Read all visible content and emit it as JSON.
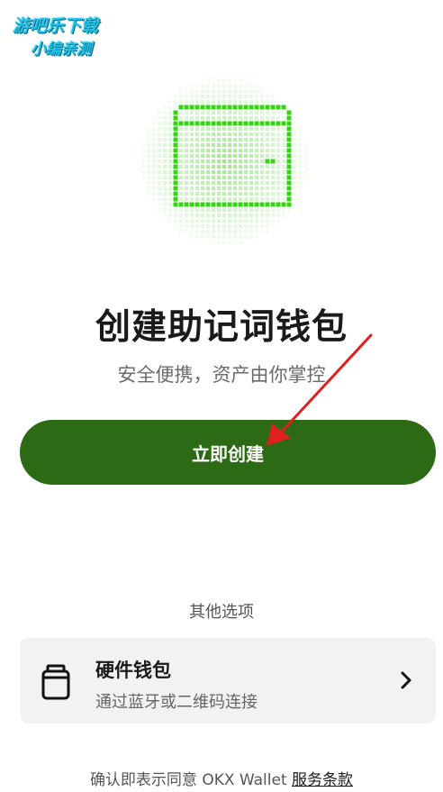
{
  "watermark": {
    "line1": "游吧乐下载",
    "line2": "小编亲测"
  },
  "hero": {
    "icon": "wallet-pixel-icon",
    "accent_color": "#35d413"
  },
  "title": "创建助记词钱包",
  "subtitle": "安全便携，资产由你掌控",
  "create_button": {
    "label": "立即创建",
    "color": "#2d6a15"
  },
  "annotation": {
    "icon": "red-arrow-annotation",
    "color": "#e0201c"
  },
  "other_options": {
    "label": "其他选项"
  },
  "hardware_wallet": {
    "title": "硬件钱包",
    "subtitle": "通过蓝牙或二维码连接",
    "icon": "hardware-wallet-icon",
    "chevron": "chevron-right-icon"
  },
  "footer": {
    "prefix": "确认即表示同意 OKX Wallet ",
    "terms_link": "服务条款"
  }
}
